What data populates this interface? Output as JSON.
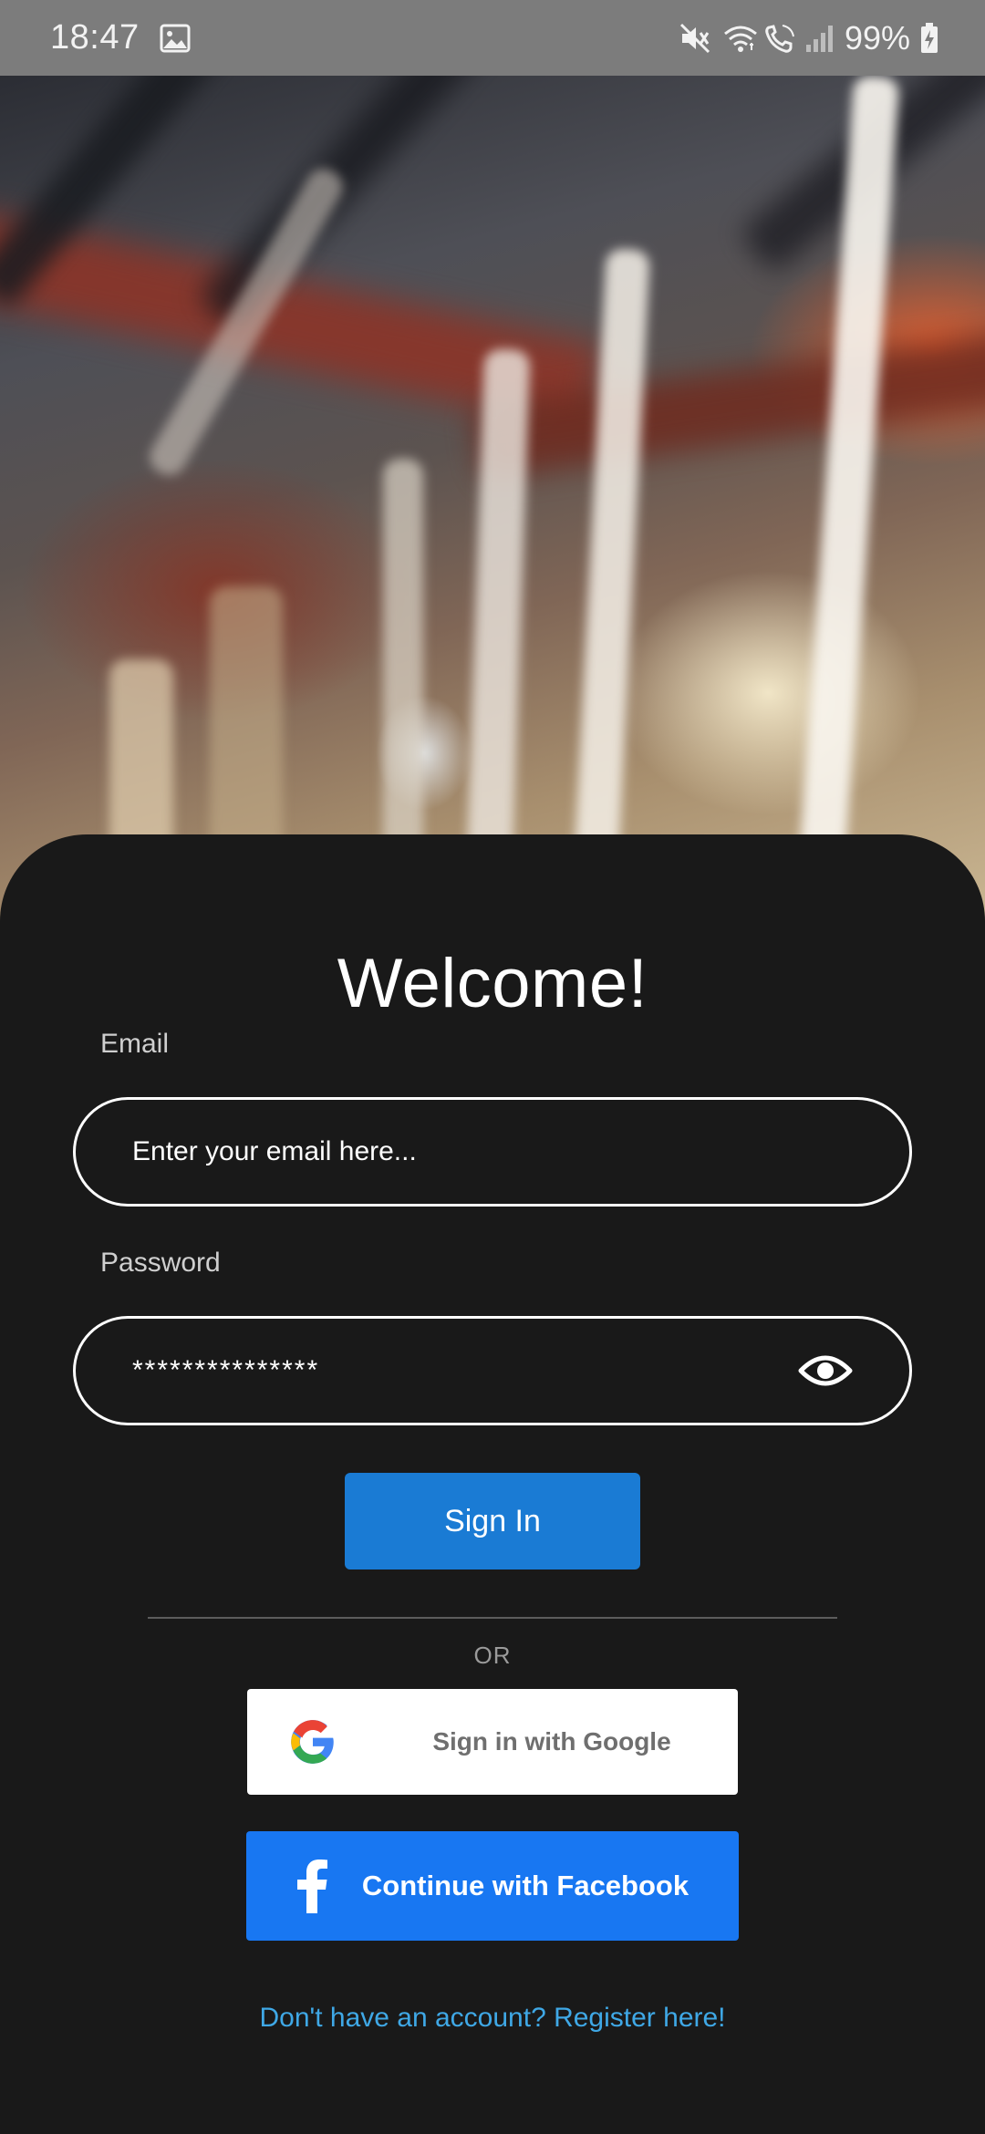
{
  "status_bar": {
    "time": "18:47",
    "battery": "99%",
    "icons": [
      "image-icon",
      "mute-icon",
      "wifi-icon",
      "wifi-call-icon",
      "signal-icon",
      "battery-charging-icon"
    ]
  },
  "hero": {
    "description_icon": "blurred-warehouse-photo"
  },
  "login": {
    "title": "Welcome!",
    "email_label": "Email",
    "email_placeholder": "Enter your email here...",
    "password_label": "Password",
    "password_value": "***************",
    "sign_in_label": "Sign In",
    "or_text": "OR",
    "google_label": "Sign in with Google",
    "facebook_label": "Continue with Facebook",
    "register_text": "Don't have an account? Register here!"
  },
  "colors": {
    "background": "#191919",
    "primary_button": "#1a7bd4",
    "facebook": "#1877f2",
    "link": "#3fa8e6",
    "status_bar": "#7c7c7c"
  }
}
